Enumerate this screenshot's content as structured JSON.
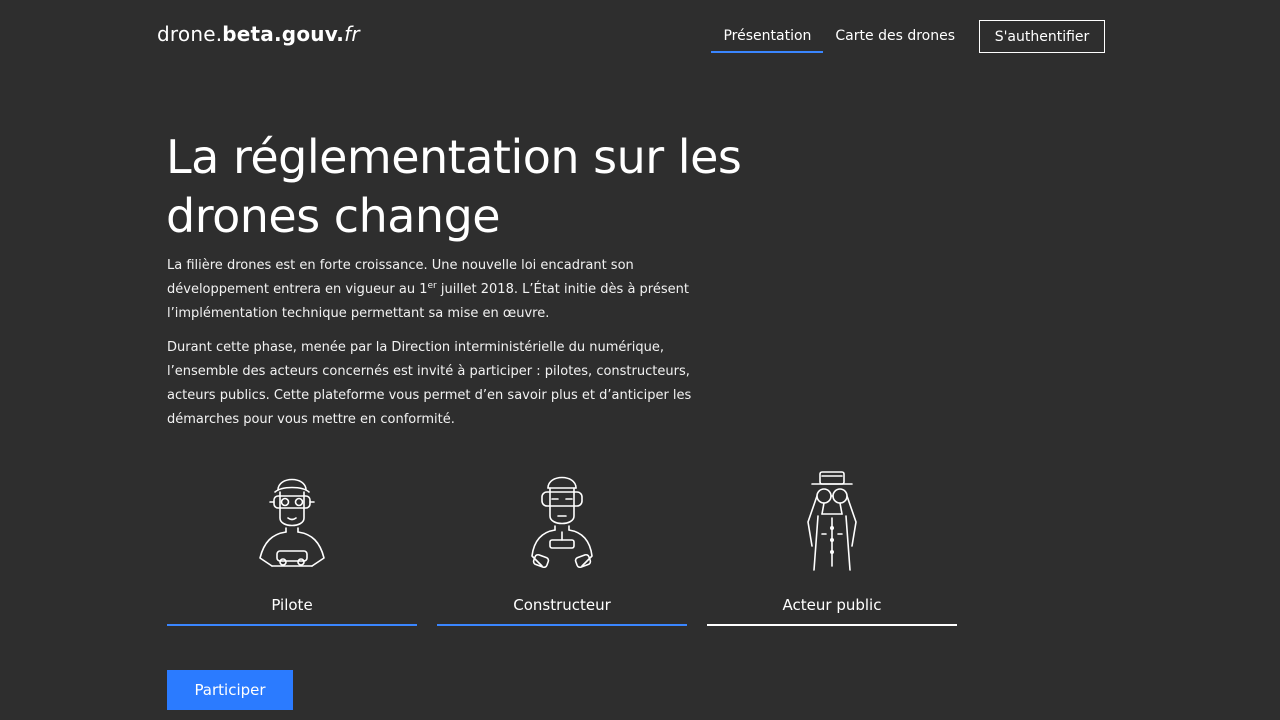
{
  "header": {
    "logo": {
      "part1": "drone.",
      "part2": "beta.gouv.",
      "part3": "fr"
    },
    "nav": [
      {
        "label": "Présentation",
        "active": true
      },
      {
        "label": "Carte des drones",
        "active": false
      }
    ],
    "auth_label": "S'authentifier",
    "accent_color": "#3a86ff"
  },
  "hero": {
    "title_line1": "La réglementation sur les",
    "title_line2": "drones change",
    "paragraph1_a": "La filière drones est en forte croissance. Une nouvelle loi encadrant son développement entrera en vigueur au 1",
    "paragraph1_sup": "er",
    "paragraph1_b": " juillet 2018. L’État initie dès à présent l’implémentation technique permettant sa mise en œuvre.",
    "paragraph2": "Durant cette phase, menée par la Direction interministérielle du numérique, l’ensemble des acteurs concernés est invité à participer : pilotes, constructeurs, acteurs publics. Cette plateforme vous permet d’en savoir plus et d’anticiper les démarches pour vous mettre en conformité."
  },
  "roles": [
    {
      "label": "Pilote",
      "icon": "pilot-icon"
    },
    {
      "label": "Constructeur",
      "icon": "builder-icon"
    },
    {
      "label": "Acteur public",
      "icon": "public-actor-icon",
      "selected": true
    }
  ],
  "cta": {
    "label": "Participer",
    "color": "#2b7bff"
  }
}
